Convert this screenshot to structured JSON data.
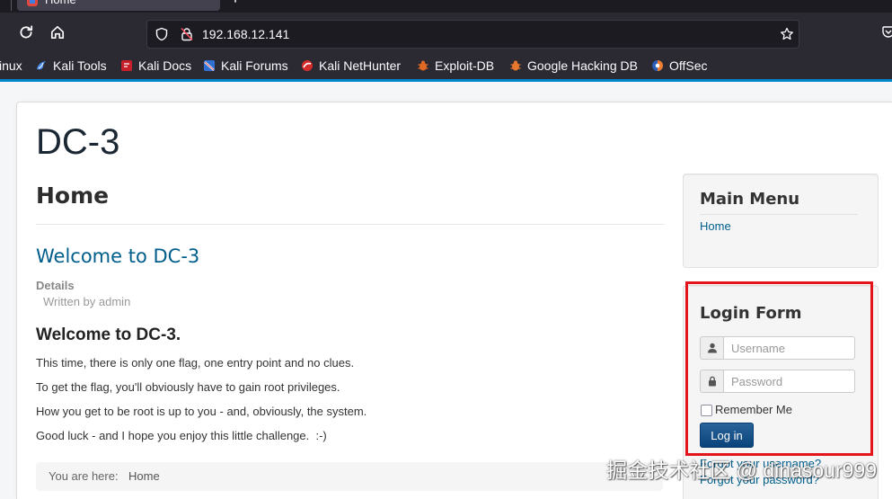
{
  "browser": {
    "tab_title": "Home",
    "url": "192.168.12.141",
    "bookmarks": [
      {
        "label": "inux"
      },
      {
        "label": "Kali Tools",
        "icon": "kali-tools-icon"
      },
      {
        "label": "Kali Docs",
        "icon": "kali-docs-icon"
      },
      {
        "label": "Kali Forums",
        "icon": "kali-forums-icon"
      },
      {
        "label": "Kali NetHunter",
        "icon": "kali-nethunter-icon"
      },
      {
        "label": "Exploit-DB",
        "icon": "exploit-db-icon"
      },
      {
        "label": "Google Hacking DB",
        "icon": "google-hacking-db-icon"
      },
      {
        "label": "OffSec",
        "icon": "offsec-icon"
      }
    ],
    "toolbar_icons": [
      "reload-icon",
      "home-icon",
      "shield-icon",
      "insecure-lock-icon",
      "bookmark-star-icon",
      "new-tab-icon"
    ]
  },
  "site": {
    "title": "DC-3",
    "page_heading": "Home",
    "article": {
      "title": "Welcome to DC-3",
      "details_label": "Details",
      "author": "Written by admin",
      "subheading": "Welcome to DC-3.",
      "paragraphs": [
        "This time, there is only one flag, one entry point and no clues.",
        "To get the flag, you'll obviously have to gain root privileges.",
        "How you get to be root is up to you - and, obviously, the system.",
        "Good luck - and I hope you enjoy this little challenge.  :-)"
      ]
    },
    "breadcrumb": {
      "label": "You are here:",
      "current": "Home"
    },
    "main_menu": {
      "title": "Main Menu",
      "items": [
        {
          "label": "Home"
        }
      ]
    },
    "login_form": {
      "title": "Login Form",
      "username": {
        "placeholder": "Username",
        "icon": "user-icon"
      },
      "password": {
        "placeholder": "Password",
        "icon": "lock-icon"
      },
      "remember_me": {
        "label": "Remember Me",
        "checked": false
      },
      "submit_label": "Log in",
      "links": [
        {
          "label": "Forgot your username?"
        },
        {
          "label": "Forgot your password?"
        }
      ]
    }
  },
  "watermark": "掘金技术社区 @ dinasour999",
  "colors": {
    "link": "#005e8d",
    "brand": "#0088cc",
    "annotation": "#e3141c",
    "button": "#0b4d8c"
  }
}
